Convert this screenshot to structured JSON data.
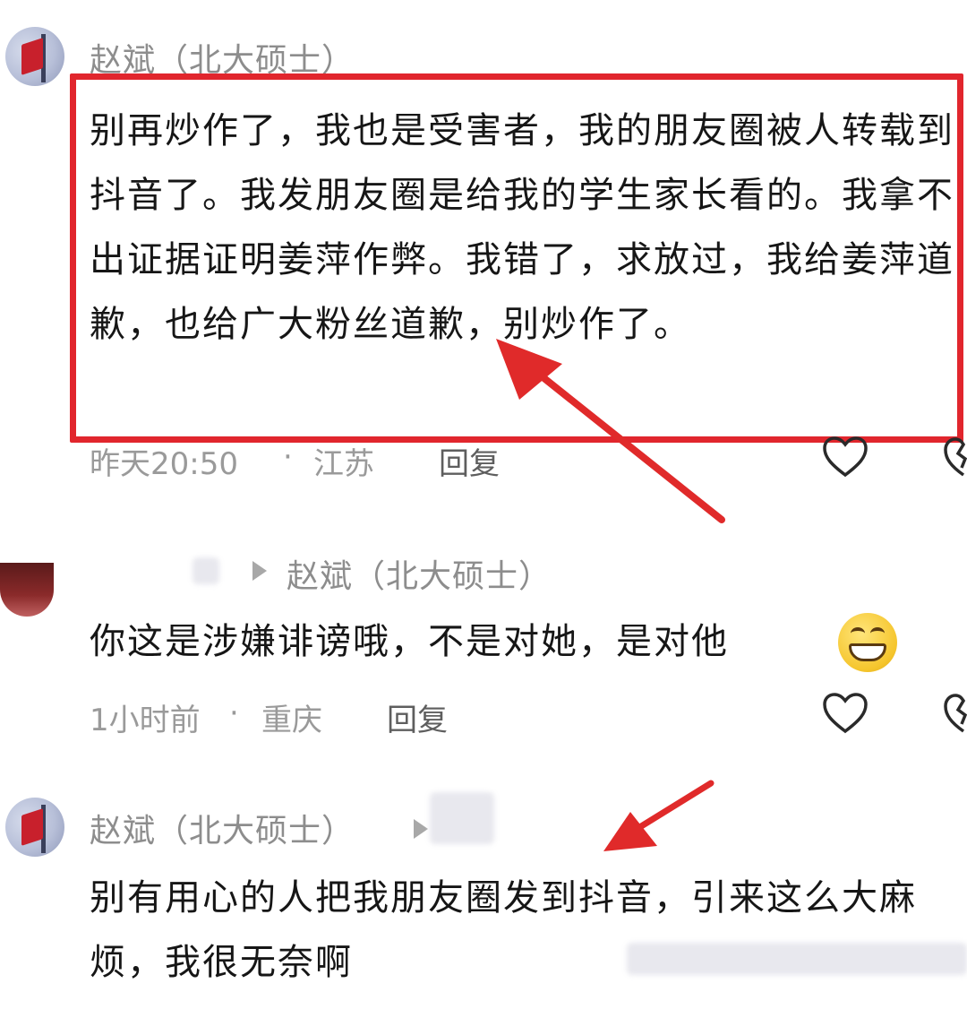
{
  "comments": [
    {
      "author": "赵斌（北大硕士）",
      "text": "别再炒作了，我也是受害者，我的朋友圈被人转载到抖音了。我发朋友圈是给我的学生家长看的。我拿不出证据证明姜萍作弊。我错了，求放过，我给姜萍道歉，也给广大粉丝道歉，别炒作了。",
      "time": "昨天20:50",
      "location": "江苏",
      "reply_label": "回复"
    },
    {
      "reply_to": "赵斌（北大硕士）",
      "text": "你这是涉嫌诽谤哦，不是对她，是对他",
      "time": "1小时前",
      "location": "重庆",
      "reply_label": "回复"
    },
    {
      "author": "赵斌（北大硕士）",
      "text": "别有用心的人把我朋友圈发到抖音，引来这么大麻烦，我很无奈啊"
    }
  ],
  "separator": "·",
  "icons": {
    "like": "heart-outline-icon",
    "dislike": "broken-heart-icon",
    "reply_arrow": "triangle-right-icon",
    "emoji": "grinning-face-icon"
  },
  "colors": {
    "highlight": "#e1262d",
    "arrow": "#e02a2a",
    "meta_text": "#9a9a9a"
  }
}
